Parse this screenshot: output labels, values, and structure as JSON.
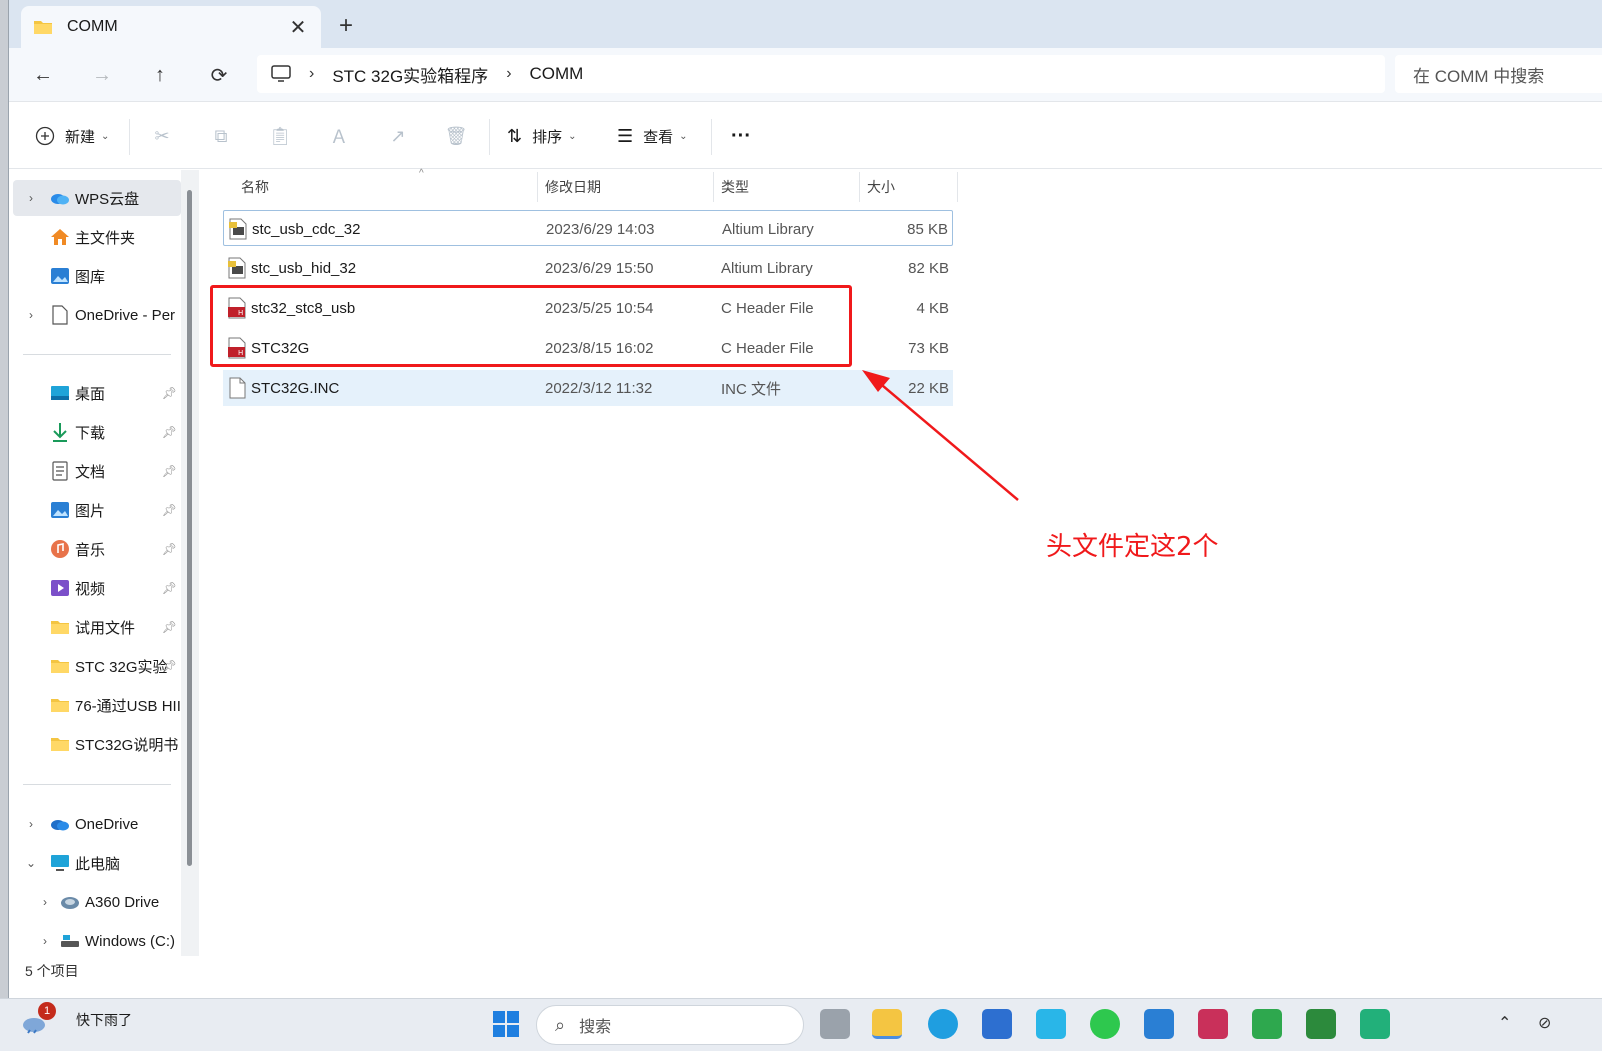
{
  "tab": {
    "title": "COMM",
    "close": "✕",
    "new": "+"
  },
  "nav": {
    "back": "←",
    "forward": "→",
    "up": "↑",
    "refresh": "⟳"
  },
  "address": {
    "crumbs": [
      "STC 32G实验箱程序",
      "COMM"
    ],
    "sep": "›"
  },
  "search": {
    "placeholder": "在 COMM 中搜索"
  },
  "toolbar": {
    "new_label": "新建",
    "sort_label": "排序",
    "view_label": "查看",
    "more": "···"
  },
  "sidebar": {
    "items": [
      {
        "label": "WPS云盘",
        "icon": "cloud-icon"
      },
      {
        "label": "主文件夹",
        "icon": "home-icon"
      },
      {
        "label": "图库",
        "icon": "gallery-icon"
      },
      {
        "label": "OneDrive - Per",
        "icon": "file-icon"
      },
      {
        "label": "桌面",
        "icon": "desktop-icon"
      },
      {
        "label": "下载",
        "icon": "download-icon"
      },
      {
        "label": "文档",
        "icon": "document-icon"
      },
      {
        "label": "图片",
        "icon": "pictures-icon"
      },
      {
        "label": "音乐",
        "icon": "music-icon"
      },
      {
        "label": "视频",
        "icon": "video-icon"
      },
      {
        "label": "试用文件",
        "icon": "folder-icon"
      },
      {
        "label": "STC 32G实验",
        "icon": "folder-icon"
      },
      {
        "label": "76-通过USB HII",
        "icon": "folder-icon"
      },
      {
        "label": "STC32G说明书",
        "icon": "folder-icon"
      },
      {
        "label": "OneDrive",
        "icon": "cloud-icon"
      },
      {
        "label": "此电脑",
        "icon": "computer-icon"
      },
      {
        "label": "A360 Drive",
        "icon": "drive-icon"
      },
      {
        "label": "Windows (C:)",
        "icon": "disk-icon"
      }
    ]
  },
  "columns": {
    "name": "名称",
    "date": "修改日期",
    "type": "类型",
    "size": "大小"
  },
  "files": [
    {
      "name": "stc_usb_cdc_32",
      "date": "2023/6/29 14:03",
      "type": "Altium Library",
      "size": "85 KB"
    },
    {
      "name": "stc_usb_hid_32",
      "date": "2023/6/29 15:50",
      "type": "Altium Library",
      "size": "82 KB"
    },
    {
      "name": "stc32_stc8_usb",
      "date": "2023/5/25 10:54",
      "type": "C Header File",
      "size": "4 KB"
    },
    {
      "name": "STC32G",
      "date": "2023/8/15 16:02",
      "type": "C Header File",
      "size": "73 KB"
    },
    {
      "name": "STC32G.INC",
      "date": "2022/3/12 11:32",
      "type": "INC 文件",
      "size": "22 KB"
    }
  ],
  "annotation": {
    "text": "头文件定这2个",
    "color": "#f0191b"
  },
  "status": {
    "count": "5 个项目"
  },
  "taskbar": {
    "weather": "快下雨了",
    "badge": "1",
    "search_placeholder": "搜索"
  }
}
